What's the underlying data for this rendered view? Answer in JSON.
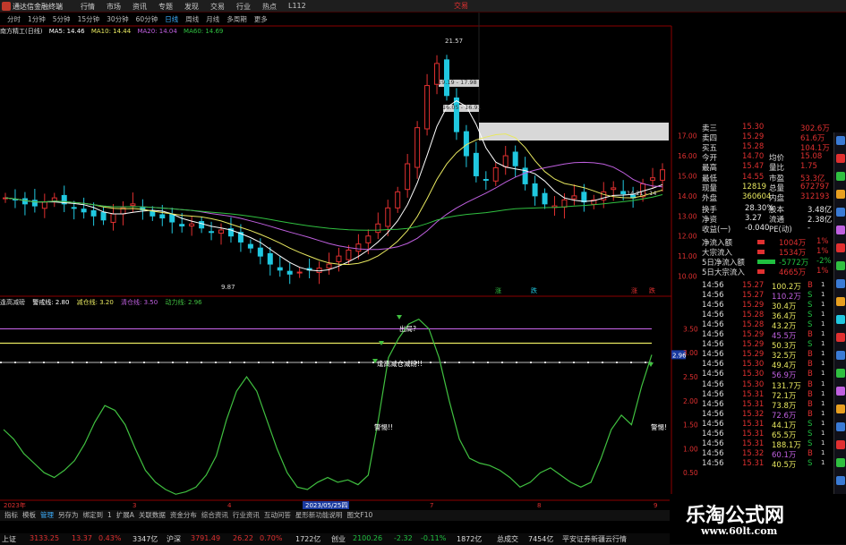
{
  "topbar": {
    "app_title": "通达信金融终端",
    "menu": [
      "行情",
      "市场",
      "资讯",
      "专题",
      "发现",
      "交易",
      "行业",
      "热点",
      "L112"
    ],
    "trade": "交易"
  },
  "periodbar": {
    "items": [
      "分时",
      "1分钟",
      "5分钟",
      "15分钟",
      "30分钟",
      "60分钟",
      "日线",
      "周线",
      "月线",
      "多周期",
      "更多"
    ],
    "active": "日线"
  },
  "main_legend": {
    "stock": "南方精工(日线)",
    "ma5": "MA5: 14.46",
    "ma10": "MA10: 14.44",
    "ma20": "MA20: 14.04",
    "ma60": "MA60: 14.69"
  },
  "sub_legend": {
    "name": "逢高减磅",
    "warn": "警戒线: 2.80",
    "reduce": "减仓线: 3.20",
    "clear": "清仓线: 3.50",
    "power": "动力线: 2.96"
  },
  "chart_annotations": {
    "high": "21.57",
    "low": "9.87",
    "zone1": "19.19 - 17.98",
    "zone2": "16.05 - 16.91",
    "zone3": "14.21 - 14",
    "marker_up": "涨",
    "marker_dn": "跌",
    "current_val": "2.96"
  },
  "sub_annotations": {
    "a1": "出局?",
    "a2": "逢高减仓减磅!!",
    "a3": "警惕!!",
    "a4": "警惕!"
  },
  "axis": {
    "price": [
      "17.00",
      "16.00",
      "15.00",
      "14.00",
      "13.00",
      "12.00",
      "11.00",
      "10.00"
    ],
    "sub": [
      "3.50",
      "3.00",
      "2.50",
      "2.00",
      "1.50",
      "1.00",
      "0.50"
    ],
    "dates": [
      "2023年",
      "3",
      "4",
      "5",
      "2023/05/25四",
      "7",
      "8",
      "9"
    ]
  },
  "colors": {
    "up": "#e03030",
    "down": "#20c8e0",
    "ma5": "#ffffff",
    "ma10": "#e8e860",
    "ma20": "#c060e0",
    "ma60": "#30c040",
    "sub": "#40c040"
  },
  "chart_data": {
    "type": "line",
    "title": "逢高减磅",
    "series": [
      {
        "name": "警戒线",
        "values": [
          2.8
        ]
      },
      {
        "name": "减仓线",
        "values": [
          3.2
        ]
      },
      {
        "name": "清仓线",
        "values": [
          3.5
        ]
      },
      {
        "name": "动力线",
        "values": [
          1.4,
          1.2,
          0.9,
          0.7,
          0.5,
          0.4,
          0.55,
          0.75,
          1.1,
          1.55,
          1.9,
          1.8,
          1.5,
          1.0,
          0.55,
          0.3,
          0.15,
          0.05,
          0.1,
          0.2,
          0.45,
          0.85,
          1.6,
          2.2,
          2.5,
          2.2,
          1.6,
          1.0,
          0.5,
          0.2,
          0.15,
          0.3,
          0.4,
          0.3,
          0.35,
          0.25,
          0.45,
          1.6,
          2.9,
          3.3,
          3.6,
          3.7,
          3.5,
          2.9,
          2.0,
          1.2,
          0.8,
          0.7,
          0.65,
          0.55,
          0.4,
          0.2,
          0.3,
          0.5,
          0.6,
          0.45,
          0.3,
          0.2,
          0.3,
          0.8,
          1.4,
          1.7,
          1.5,
          2.3,
          2.96
        ]
      }
    ],
    "ylim": [
      0,
      3.9
    ],
    "price_ylim": [
      9.4,
      21.8
    ]
  },
  "quote": {
    "top": [
      {
        "label": "卖三",
        "val": "15.30",
        "v2": "302.6万"
      },
      {
        "label": "卖四",
        "val": "15.29",
        "v2": "61.6万"
      },
      {
        "label": "买五",
        "val": "15.28",
        "v2": "104.1万"
      },
      {
        "label": "今开",
        "val": "14.70",
        "t": "均价",
        "v2": "15.08"
      },
      {
        "label": "最高",
        "val": "15.47",
        "t": "量比",
        "v2": "1.75"
      },
      {
        "label": "最低",
        "val": "14.55",
        "t": "市盈",
        "v2": "53.3亿"
      },
      {
        "label": "现量",
        "val": "12819",
        "t": "总量",
        "v2": "672797"
      },
      {
        "label": "外盘",
        "val": "360604",
        "t": "内盘",
        "v2": "312193"
      }
    ],
    "mid": [
      {
        "label": "换手",
        "val": "28.30%",
        "t": "股本",
        "v2": "3.48亿"
      },
      {
        "label": "净资",
        "val": "3.27",
        "t": "流通",
        "v2": "2.38亿"
      },
      {
        "label": "收益(一)",
        "val": "-0.040",
        "t": "PE(动)",
        "v2": "-"
      }
    ],
    "flow": [
      {
        "label": "净流入额",
        "val": "1004万",
        "pct": "1%"
      },
      {
        "label": "大宗流入",
        "val": "1534万",
        "pct": "1%"
      },
      {
        "label": "5日净流入额",
        "val": "-5772万",
        "pct": "-2%"
      },
      {
        "label": "5日大宗流入",
        "val": "4665万",
        "pct": "1%"
      }
    ],
    "ticks": [
      {
        "t": "14:56",
        "p": "15.27",
        "v": "100.2万",
        "d": "B"
      },
      {
        "t": "14:56",
        "p": "15.27",
        "v": "110.2万",
        "d": "S"
      },
      {
        "t": "14:56",
        "p": "15.29",
        "v": "30.4万",
        "d": "S"
      },
      {
        "t": "14:56",
        "p": "15.28",
        "v": "36.4万",
        "d": "S"
      },
      {
        "t": "14:56",
        "p": "15.28",
        "v": "43.2万",
        "d": "S"
      },
      {
        "t": "14:56",
        "p": "15.29",
        "v": "45.5万",
        "d": "B"
      },
      {
        "t": "14:56",
        "p": "15.29",
        "v": "50.3万",
        "d": "S"
      },
      {
        "t": "14:56",
        "p": "15.29",
        "v": "32.5万",
        "d": "B"
      },
      {
        "t": "14:56",
        "p": "15.30",
        "v": "49.4万",
        "d": "B"
      },
      {
        "t": "14:56",
        "p": "15.30",
        "v": "56.9万",
        "d": "B"
      },
      {
        "t": "14:56",
        "p": "15.30",
        "v": "131.7万",
        "d": "B"
      },
      {
        "t": "14:56",
        "p": "15.31",
        "v": "72.1万",
        "d": "B"
      },
      {
        "t": "14:56",
        "p": "15.31",
        "v": "73.8万",
        "d": "B"
      },
      {
        "t": "14:56",
        "p": "15.32",
        "v": "72.6万",
        "d": "B"
      },
      {
        "t": "14:56",
        "p": "15.31",
        "v": "44.1万",
        "d": "S"
      },
      {
        "t": "14:56",
        "p": "15.31",
        "v": "65.5万",
        "d": "S"
      },
      {
        "t": "14:56",
        "p": "15.31",
        "v": "188.1万",
        "d": "S"
      },
      {
        "t": "14:56",
        "p": "15.32",
        "v": "60.1万",
        "d": "B"
      },
      {
        "t": "14:56",
        "p": "15.31",
        "v": "40.5万",
        "d": "S"
      }
    ]
  },
  "bottomtabs": [
    "指标",
    "模板",
    "管理",
    "另存为",
    "绑定到",
    "1",
    "扩展A",
    "关联数据",
    "资金分布",
    "综合资讯",
    "行业资讯",
    "互动问答",
    "星形新功能说明",
    "图文F10"
  ],
  "statusbar": {
    "sh": "上证",
    "sh_val": "3133.25",
    "sh_chg": "13.37",
    "sh_pct": "0.43%",
    "sh_amt": "3347亿",
    "sz": "沪深",
    "sz_val": "3791.49",
    "sz_chg": "26.22",
    "sz_pct": "0.70%",
    "sz_amt": "1722亿",
    "cy": "创业",
    "cy_val": "2100.26",
    "cy_chg": "-2.32",
    "cy_pct": "-0.11%",
    "cy_amt": "1872亿",
    "total": "总成交",
    "total_val": "7454亿",
    "broker": "平安证券新疆云行情"
  },
  "watermark": {
    "title": "乐淘公式网",
    "url": "www.60lt.com"
  }
}
